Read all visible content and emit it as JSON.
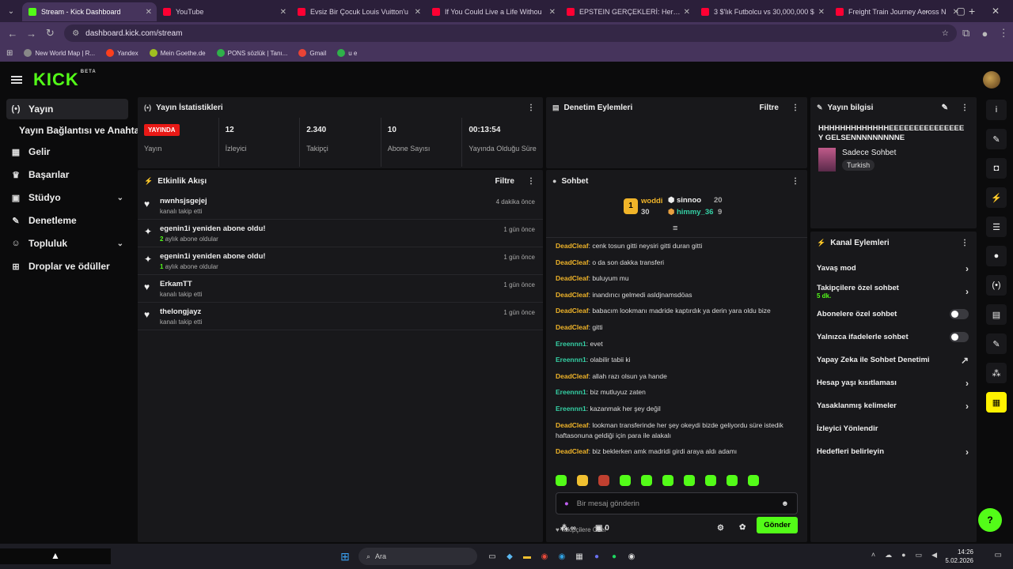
{
  "browser": {
    "tabs": [
      {
        "title": "Stream - Kick Dashboard",
        "color": "#53fc18",
        "active": true
      },
      {
        "title": "YouTube",
        "color": "#ff0033",
        "active": false
      },
      {
        "title": "Evsiz Bir Çocuk Louis Vuitton'u",
        "color": "#ff0033",
        "active": false
      },
      {
        "title": "If You Could Live a Life Withou",
        "color": "#ff0033",
        "active": false
      },
      {
        "title": "EPSTEIN GERÇEKLERİ: Her Şey",
        "color": "#ff0033",
        "active": false
      },
      {
        "title": "3 $'lık Futbolcu vs 30,000,000 $",
        "color": "#ff0033",
        "active": false
      },
      {
        "title": "Freight Train Journey Across N",
        "color": "#ff0033",
        "active": false
      }
    ],
    "url": "dashboard.kick.com/stream",
    "bookmarks": [
      {
        "label": "New World Map | R...",
        "color": "#888888"
      },
      {
        "label": "Yandex",
        "color": "#fc3f1d"
      },
      {
        "label": "Mein Goethe.de",
        "color": "#a0c020"
      },
      {
        "label": "PONS sözlük | Tanı...",
        "color": "#2fb14a"
      },
      {
        "label": "Gmail",
        "color": "#ea4335"
      },
      {
        "label": "u e",
        "color": "#2fb14a"
      }
    ]
  },
  "app": {
    "logo": "KICK",
    "logo_sup": "BETA"
  },
  "sidebar": {
    "items": [
      {
        "icon": "(•)",
        "label": "Yayın",
        "active": true
      },
      {
        "sub": true,
        "label": "Yayın Bağlantısı ve Anahtarı"
      },
      {
        "icon": "▦",
        "label": "Gelir"
      },
      {
        "icon": "♛",
        "label": "Başarılar"
      },
      {
        "icon": "▣",
        "label": "Stüdyo",
        "chevron": true
      },
      {
        "icon": "✎",
        "label": "Denetleme"
      },
      {
        "icon": "☺",
        "label": "Topluluk",
        "chevron": true
      },
      {
        "icon": "⊞",
        "label": "Droplar ve ödüller"
      }
    ]
  },
  "stats_panel": {
    "title": "Yayın İstatistikleri",
    "live_badge": "YAYINDA",
    "stats": [
      {
        "value": "",
        "label": "Yayın"
      },
      {
        "value": "12",
        "label": "İzleyici"
      },
      {
        "value": "2.340",
        "label": "Takipçi"
      },
      {
        "value": "10",
        "label": "Abone Sayısı"
      },
      {
        "value": "00:13:54",
        "label": "Yayında Olduğu Süre"
      }
    ]
  },
  "activity_panel": {
    "title": "Etkinlik Akışı",
    "filter": "Filtre",
    "items": [
      {
        "icon": "♥",
        "user": "nwnhsjsgejej",
        "detail": "kanalı takip etti",
        "time": "4 dakika önce"
      },
      {
        "icon": "✦",
        "user": "egenin1i yeniden abone oldu!",
        "detail_num": "2",
        "detail": " aylık abone oldular",
        "time": "1 gün önce"
      },
      {
        "icon": "✦",
        "user": "egenin1i yeniden abone oldu!",
        "detail_num": "1",
        "detail": " aylık abone oldular",
        "time": "1 gün önce"
      },
      {
        "icon": "♥",
        "user": "ErkamTT",
        "detail": "kanalı takip etti",
        "time": "1 gün önce"
      },
      {
        "icon": "♥",
        "user": "thelongjayz",
        "detail": "kanalı takip etti",
        "time": "1 gün önce"
      }
    ]
  },
  "moderation_panel": {
    "title": "Denetim Eylemleri",
    "filter": "Filtre"
  },
  "chat_panel": {
    "title": "Sohbet",
    "leaders": {
      "first_name": "woddi",
      "first_score": "30",
      "second_name": "sinnoo",
      "second_score": "20",
      "third_name": "himmy_36",
      "third_score": "9"
    },
    "messages": [
      {
        "user": "DeadCleaf",
        "cls": "u1",
        "text": "cenk tosun gitti neysiri gitti duran gitti"
      },
      {
        "user": "DeadCleaf",
        "cls": "u1",
        "text": "o da son dakka transferi"
      },
      {
        "user": "DeadCleaf",
        "cls": "u1",
        "text": "buluyum mu"
      },
      {
        "user": "DeadCleaf",
        "cls": "u1",
        "text": "inandırıcı gelmedi asldjnamsdöas"
      },
      {
        "user": "DeadCleaf",
        "cls": "u1",
        "text": "babacım lookmanı madride kaptırdık ya derin yara oldu bize"
      },
      {
        "user": "DeadCleaf",
        "cls": "u1",
        "text": "gitti"
      },
      {
        "user": "Ereennn1",
        "cls": "u2",
        "text": "evet"
      },
      {
        "user": "Ereennn1",
        "cls": "u2",
        "text": "olabilir tabii ki"
      },
      {
        "user": "DeadCleaf",
        "cls": "u1",
        "text": "allah razı olsun ya hande"
      },
      {
        "user": "Ereennn1",
        "cls": "u2",
        "text": "biz mutluyuz zaten"
      },
      {
        "user": "Ereennn1",
        "cls": "u2",
        "text": "kazanmak her şey değil"
      },
      {
        "user": "DeadCleaf",
        "cls": "u1",
        "text": "lookman transferinde her şey okeydi bizde geliyordu süre istedik haftasonuna geldiği için para ile alakalı"
      },
      {
        "user": "DeadCleaf",
        "cls": "u1",
        "text": "biz beklerken amk madridi girdi araya aldı adamı"
      }
    ],
    "followers_only": "Takipçilere Özel",
    "input_placeholder": "Bir mesaj gönderin",
    "infinity": "∞",
    "points": "0",
    "send": "Gönder"
  },
  "info_panel": {
    "title": "Yayın bilgisi",
    "stream_title": "HHHHHHHHHHHHHEEEEEEEEEEEEEEEY GELSENNNNNNNNNE",
    "category": "Sadece Sohbet",
    "language": "Turkish"
  },
  "channel_panel": {
    "title": "Kanal Eylemleri",
    "rows": [
      {
        "label": "Yavaş mod",
        "kind": "arrow"
      },
      {
        "label": "Takipçilere özel sohbet",
        "sub": "5 dk.",
        "kind": "arrow"
      },
      {
        "label": "Abonelere özel sohbet",
        "kind": "toggle"
      },
      {
        "label": "Yalnızca ifadelerle sohbet",
        "kind": "toggle"
      },
      {
        "label": "Yapay Zeka ile Sohbet Denetimi",
        "kind": "ext"
      },
      {
        "label": "Hesap yaşı kısıtlaması",
        "kind": "arrow"
      },
      {
        "label": "Yasaklanmış kelimeler",
        "kind": "arrow"
      },
      {
        "label": "İzleyici Yönlendir",
        "kind": "none"
      },
      {
        "label": "Hedefleri belirleyin",
        "kind": "arrow"
      }
    ]
  },
  "taskbar": {
    "search": "Ara",
    "time": "14:26",
    "date": "5.02.2026"
  }
}
